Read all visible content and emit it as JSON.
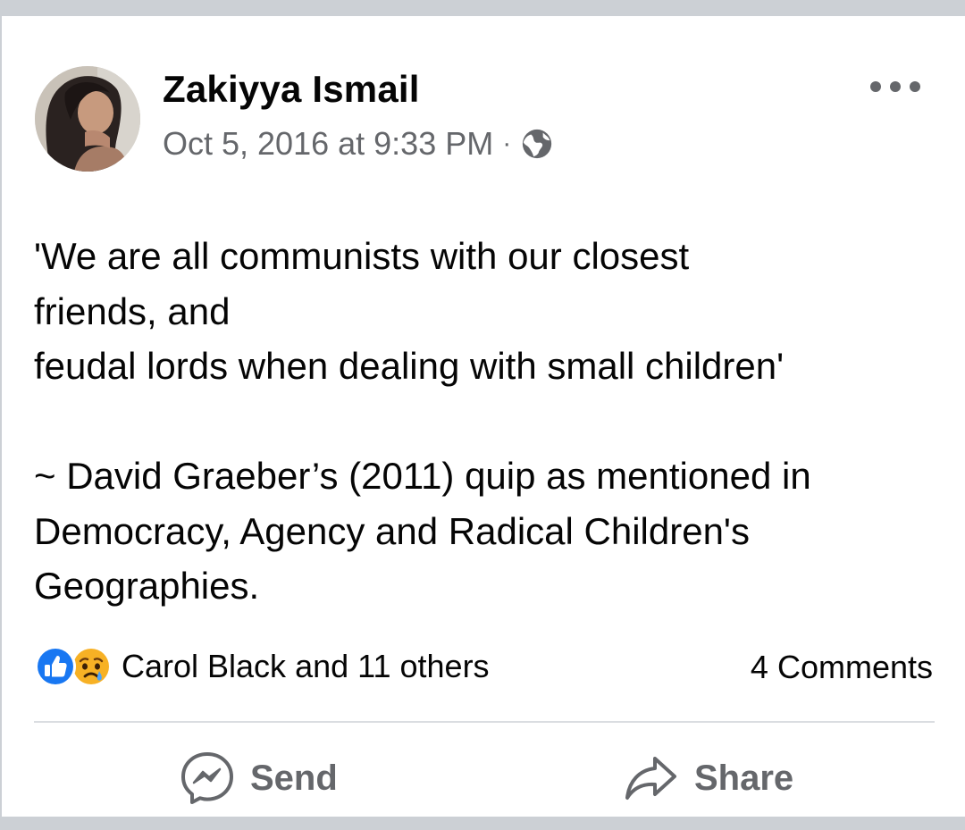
{
  "post": {
    "author": "Zakiyya Ismail",
    "timestamp": "Oct 5, 2016 at 9:33 PM",
    "separator": "·",
    "audience_icon": "globe-icon",
    "more_icon": "more-options-icon",
    "text": "'We are all communists with our closest\nfriends, and\nfeudal lords when dealing with small children'\n\n~ David Graeber’s (2011) quip as mentioned in\nDemocracy, Agency and Radical Children's\nGeographies."
  },
  "engagement": {
    "reaction_icons": [
      "like-reaction-icon",
      "sad-reaction-icon"
    ],
    "reactions_label": "Carol Black and 11 others",
    "comments_label": "4 Comments"
  },
  "actions": {
    "send_label": "Send",
    "share_label": "Share"
  },
  "colors": {
    "background": "#ccd0d5",
    "card": "#ffffff",
    "primary_text": "#050505",
    "secondary_text": "#65676b",
    "like_blue": "#1877f2",
    "divider": "#dadde1"
  }
}
